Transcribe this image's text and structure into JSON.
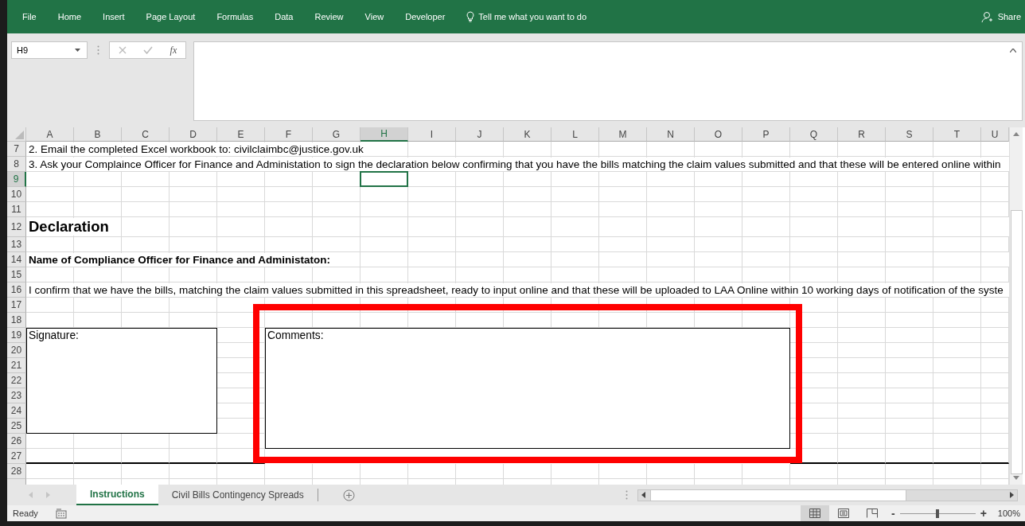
{
  "ribbon": {
    "tabs": [
      {
        "label": "File"
      },
      {
        "label": "Home"
      },
      {
        "label": "Insert"
      },
      {
        "label": "Page Layout"
      },
      {
        "label": "Formulas"
      },
      {
        "label": "Data"
      },
      {
        "label": "Review"
      },
      {
        "label": "View"
      },
      {
        "label": "Developer"
      }
    ],
    "tell_me": "Tell me what you want to do",
    "share": "Share"
  },
  "formula_bar": {
    "name_box": "H9",
    "function_symbol": "fx"
  },
  "sheet": {
    "columns": [
      {
        "label": "A",
        "selected": false
      },
      {
        "label": "B",
        "selected": false
      },
      {
        "label": "C",
        "selected": false
      },
      {
        "label": "D",
        "selected": false
      },
      {
        "label": "E",
        "selected": false
      },
      {
        "label": "F",
        "selected": false
      },
      {
        "label": "G",
        "selected": false
      },
      {
        "label": "H",
        "selected": true
      },
      {
        "label": "I",
        "selected": false
      },
      {
        "label": "J",
        "selected": false
      },
      {
        "label": "K",
        "selected": false
      },
      {
        "label": "L",
        "selected": false
      },
      {
        "label": "M",
        "selected": false
      },
      {
        "label": "N",
        "selected": false
      },
      {
        "label": "O",
        "selected": false
      },
      {
        "label": "P",
        "selected": false
      },
      {
        "label": "Q",
        "selected": false
      },
      {
        "label": "R",
        "selected": false
      },
      {
        "label": "S",
        "selected": false
      },
      {
        "label": "T",
        "selected": false
      },
      {
        "label": "U",
        "selected": false
      }
    ],
    "rows": [
      {
        "number": "7",
        "selected": false,
        "kind": "text",
        "text": "2. Email the completed Excel workbook to: civilclaimbc@justice.gov.uk"
      },
      {
        "number": "8",
        "selected": false,
        "kind": "text",
        "text": "3. Ask your Complaince Officer for Finance and Administation to sign the declaration below confirming that you have the bills matching the claim values submitted and that these will be entered online within"
      },
      {
        "number": "9",
        "selected": true,
        "kind": "empty"
      },
      {
        "number": "10",
        "selected": false,
        "kind": "empty"
      },
      {
        "number": "11",
        "selected": false,
        "kind": "empty"
      },
      {
        "number": "12",
        "selected": false,
        "kind": "heading",
        "text": "Declaration"
      },
      {
        "number": "13",
        "selected": false,
        "kind": "empty"
      },
      {
        "number": "14",
        "selected": false,
        "kind": "label",
        "text": "Name of Compliance Officer for Finance and Administaton:"
      },
      {
        "number": "15",
        "selected": false,
        "kind": "empty"
      },
      {
        "number": "16",
        "selected": false,
        "kind": "text",
        "text": "I confirm that we have the bills, matching the claim values submitted in this spreadsheet, ready to input online and that these will be uploaded to LAA Online within 10 working days of notification of the syste"
      },
      {
        "number": "17",
        "selected": false,
        "kind": "empty"
      },
      {
        "number": "18",
        "selected": false,
        "kind": "empty"
      },
      {
        "number": "19",
        "selected": false,
        "kind": "empty"
      },
      {
        "number": "20",
        "selected": false,
        "kind": "empty"
      },
      {
        "number": "21",
        "selected": false,
        "kind": "empty"
      },
      {
        "number": "22",
        "selected": false,
        "kind": "empty"
      },
      {
        "number": "23",
        "selected": false,
        "kind": "empty"
      },
      {
        "number": "24",
        "selected": false,
        "kind": "empty"
      },
      {
        "number": "25",
        "selected": false,
        "kind": "empty"
      },
      {
        "number": "26",
        "selected": false,
        "kind": "empty"
      },
      {
        "number": "27",
        "selected": false,
        "kind": "empty"
      },
      {
        "number": "28",
        "selected": false,
        "kind": "empty"
      }
    ],
    "boxes": [
      {
        "label": "Signature:"
      },
      {
        "label": "Comments:"
      }
    ]
  },
  "sheet_tabs": [
    {
      "label": "Instructions",
      "selected": true
    },
    {
      "label": "Civil Bills Contingency Spreads",
      "selected": false
    }
  ],
  "status_bar": {
    "text": "Ready",
    "views": [
      {
        "kind": "normal",
        "selected": true
      },
      {
        "kind": "page-layout",
        "selected": false
      },
      {
        "kind": "page-break",
        "selected": false
      }
    ],
    "zoom_minus": "-",
    "zoom_plus": "+",
    "zoom": {
      "level": 0.5
    },
    "zoom_text": "100%"
  }
}
